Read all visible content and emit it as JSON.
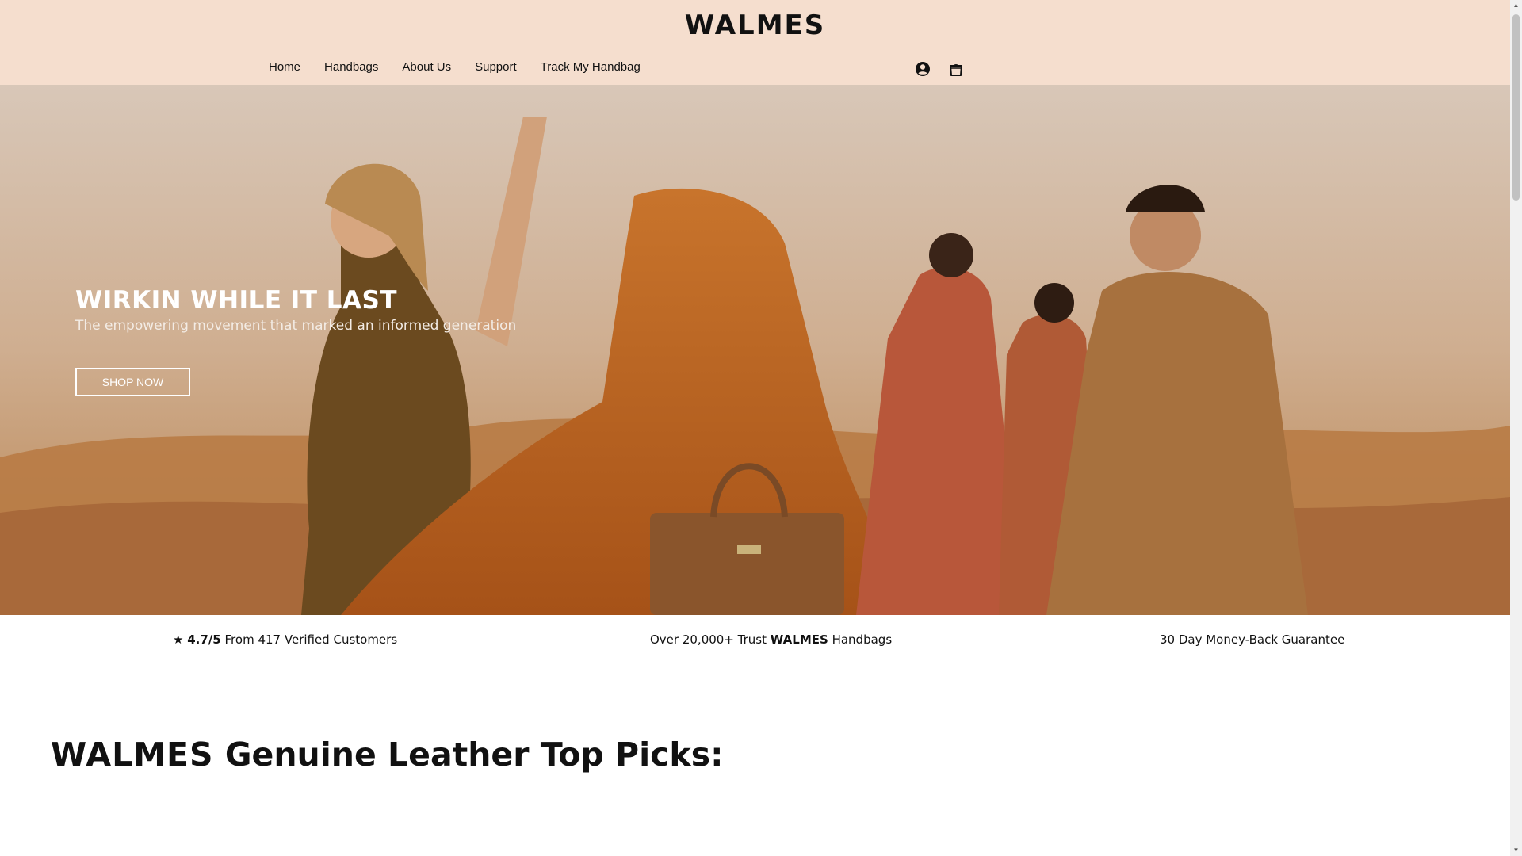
{
  "header": {
    "logo": "WALMES",
    "nav": [
      "Home",
      "Handbags",
      "About Us",
      "Support",
      "Track My Handbag"
    ],
    "icons": [
      "account-icon",
      "shopping-bag-icon"
    ],
    "background": "#f5dece"
  },
  "hero": {
    "title": "WIRKIN WHILE IT LAST",
    "subtitle": "The empowering movement that marked an informed generation",
    "button": "SHOP NOW"
  },
  "trust": {
    "rating_star": "★",
    "rating_value": "4.7/5",
    "rating_text": "From 417 Verified Customers",
    "trust_prefix": "Over 20,000+ Trust",
    "trust_brand": "WALMES",
    "trust_suffix": "Handbags",
    "guarantee": "30 Day Money-Back Guarantee"
  },
  "section": {
    "brand": "WALMES",
    "title": "Genuine Leather Top Picks:"
  }
}
